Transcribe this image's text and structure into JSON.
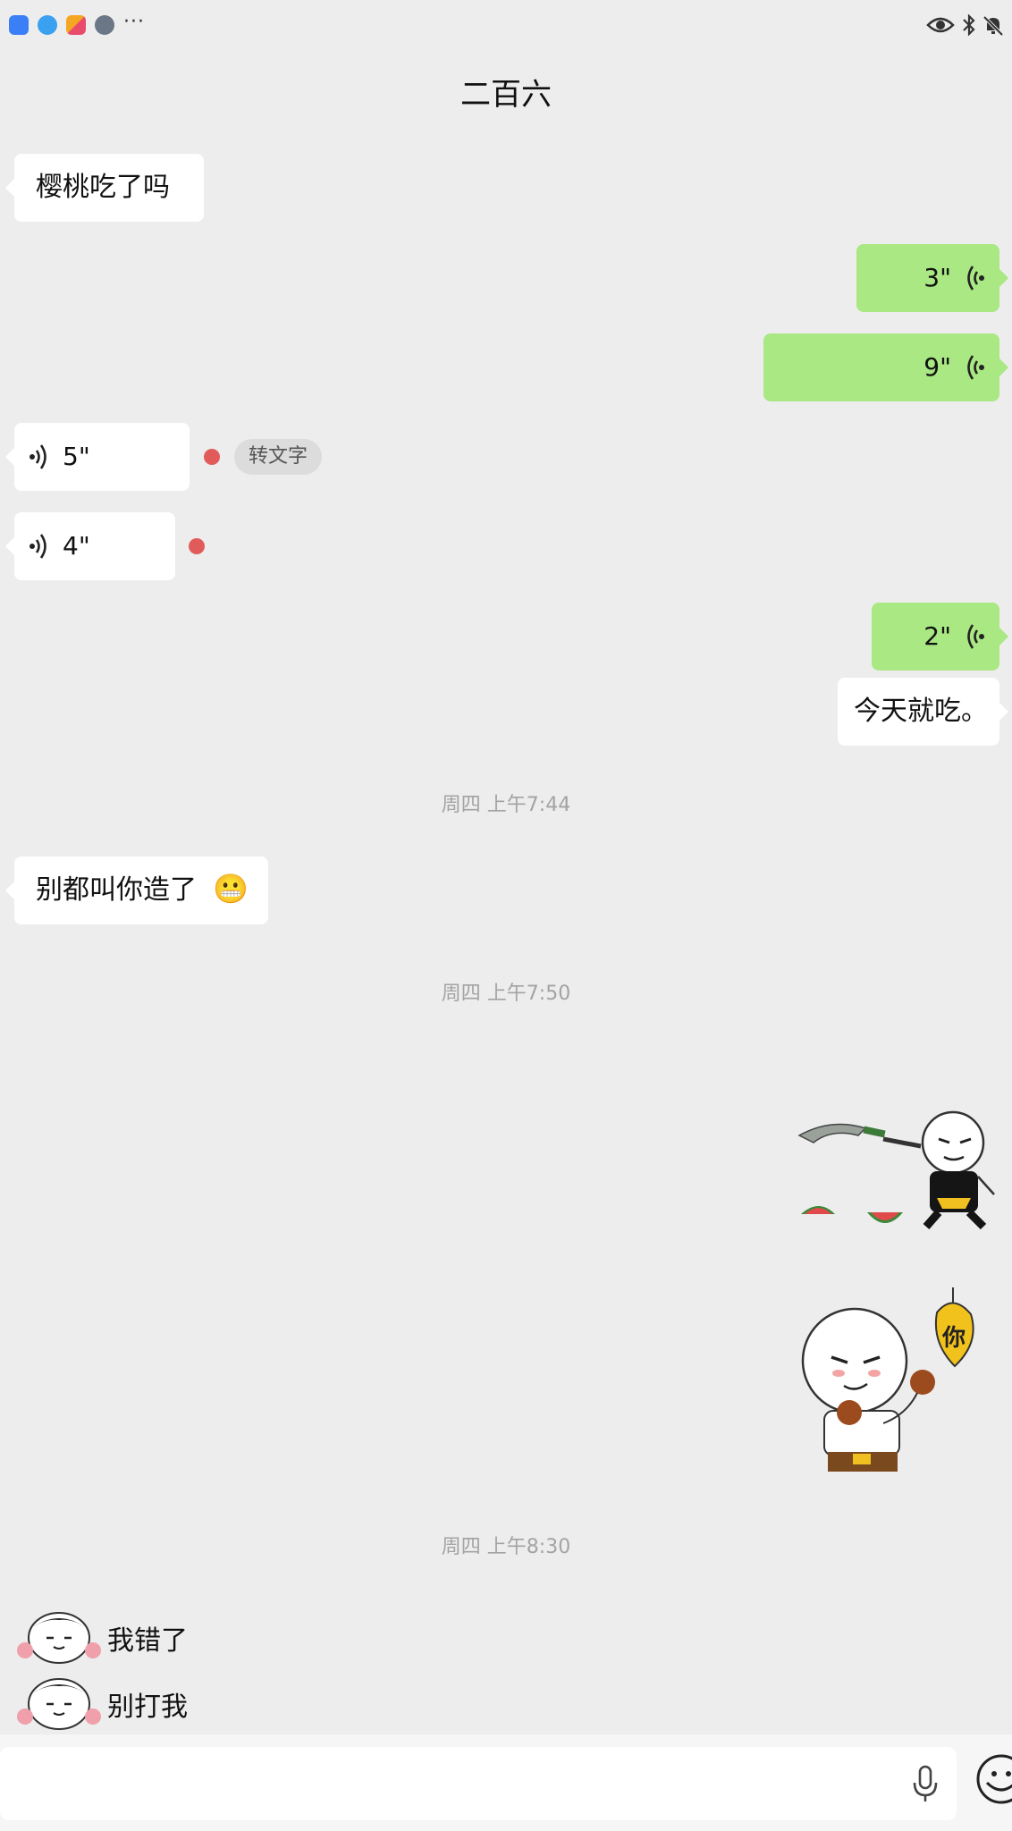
{
  "header": {
    "title": "二百六"
  },
  "messages": {
    "m1": "樱桃吃了吗",
    "v1": "3\"",
    "v2": "9\"",
    "v3": "5\"",
    "v3_action": "转文字",
    "v4": "4\"",
    "v5": "2\"",
    "m2": "今天就吃。",
    "ts1": "周四 上午7:44",
    "m3": "别都叫你造了",
    "m3_emoji": "😬",
    "ts2": "周四 上午7:50",
    "sticker2_text": "你",
    "ts3": "周四 上午8:30",
    "s1": "我错了",
    "s2": "别打我"
  },
  "colors": {
    "sent_bubble": "#a9e882",
    "received_bubble": "#ffffff",
    "unread": "#e25b5b",
    "background": "#ededed"
  },
  "icons": [
    "weather-app-icon",
    "browser-app-icon",
    "app-grid-icon",
    "avatar-icon",
    "eye-icon",
    "bluetooth-icon",
    "mute-bell-icon",
    "mic-icon",
    "emoji-icon",
    "voice-wave-icon"
  ]
}
